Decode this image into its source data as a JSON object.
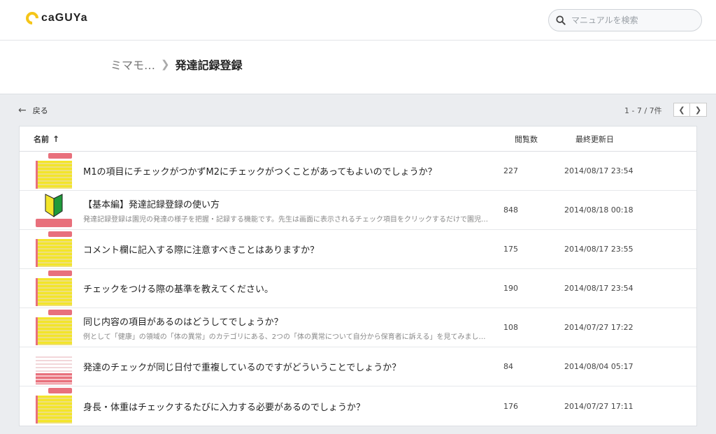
{
  "header": {
    "logo_text": "caGUYa",
    "search_placeholder": "マニュアルを検索"
  },
  "breadcrumb": {
    "parent": "ミマモ…",
    "current": "発達記録登録"
  },
  "toolbar": {
    "back_label": "戻る",
    "pager_text": "1 - 7 / 7件"
  },
  "table": {
    "columns": {
      "name": "名前",
      "views": "閲覧数",
      "updated": "最終更新日"
    },
    "rows": [
      {
        "title": "M1の項目にチェックがつかずM2にチェックがつくことがあってもよいのでしょうか？",
        "excerpt": "",
        "views": "227",
        "updated": "2014/08/17 23:54",
        "thumb": "yellow"
      },
      {
        "title": "【基本編】発達記録登録の使い方",
        "excerpt": "発達記録登録は園児の発達の様子を把握・記録する機能です。先生は画面に表示されるチェック項目をクリックするだけで園児…",
        "views": "848",
        "updated": "2014/08/18 00:18",
        "thumb": "wakaba"
      },
      {
        "title": "コメント欄に記入する際に注意すべきことはありますか？",
        "excerpt": "",
        "views": "175",
        "updated": "2014/08/17 23:55",
        "thumb": "yellow"
      },
      {
        "title": "チェックをつける際の基準を教えてください。",
        "excerpt": "",
        "views": "190",
        "updated": "2014/08/17 23:54",
        "thumb": "yellow"
      },
      {
        "title": "同じ内容の項目があるのはどうしてでしょうか？",
        "excerpt": "例として「健康」の領域の「体の異常」のカテゴリにある、2つの「体の異常について自分から保育者に訴える」を見てみまし…",
        "views": "108",
        "updated": "2014/07/27 17:22",
        "thumb": "yellow"
      },
      {
        "title": "発達のチェックが同じ日付で重複しているのですがどういうことでしょうか？",
        "excerpt": "",
        "views": "84",
        "updated": "2014/08/04 05:17",
        "thumb": "light"
      },
      {
        "title": "身長・体重はチェックするたびに入力する必要があるのでしょうか？",
        "excerpt": "",
        "views": "176",
        "updated": "2014/07/27 17:11",
        "thumb": "yellow"
      }
    ]
  },
  "colors": {
    "accent_yellow": "#f5c518",
    "thumb_pink": "#e8707c",
    "thumb_yellow": "#f3e52a"
  }
}
